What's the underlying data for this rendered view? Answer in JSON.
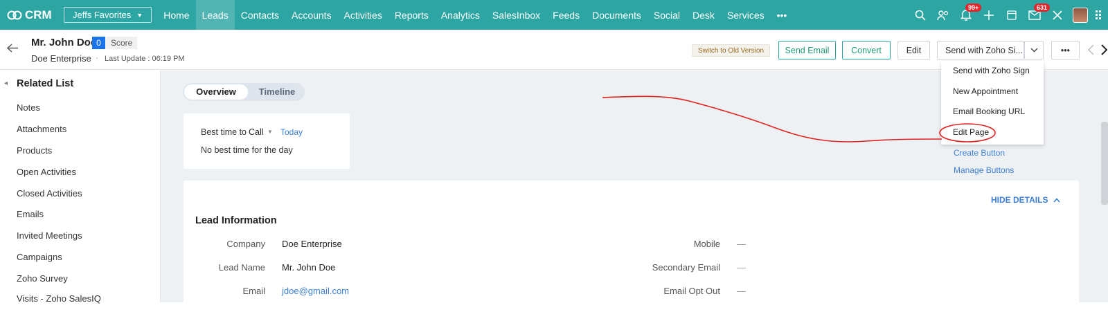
{
  "nav": {
    "app_name": "CRM",
    "favorites": "Jeffs Favorites",
    "tabs": [
      "Home",
      "Leads",
      "Contacts",
      "Accounts",
      "Activities",
      "Reports",
      "Analytics",
      "SalesInbox",
      "Feeds",
      "Documents",
      "Social",
      "Desk",
      "Services"
    ],
    "active_tab": "Leads",
    "more": "•••",
    "notification_badge": "99+",
    "mail_badge": "631",
    "icons": [
      "search-icon",
      "contacts-icon",
      "bell-icon",
      "plus-icon",
      "calendar-icon",
      "mail-icon",
      "tools-icon",
      "avatar",
      "apps-grid-icon"
    ],
    "accent_color": "#2ca5a3"
  },
  "record": {
    "name": "Mr. John Doe",
    "score_value": "0",
    "score_label": "Score",
    "company": "Doe Enterprise",
    "last_update": "Last Update : 06:19 PM"
  },
  "actions": {
    "switch_old": "Switch to Old Version",
    "send_email": "Send Email",
    "convert": "Convert",
    "edit": "Edit",
    "send_with_sign": "Send with Zoho Si...",
    "more": "•••"
  },
  "dropdown": {
    "items": [
      "Send with Zoho Sign",
      "New Appointment",
      "Email Booking URL",
      "Edit Page"
    ],
    "links": [
      "Create Button",
      "Manage Buttons"
    ]
  },
  "sidebar": {
    "title": "Related List",
    "items": [
      "Notes",
      "Attachments",
      "Products",
      "Open Activities",
      "Closed Activities",
      "Emails",
      "Invited Meetings",
      "Campaigns",
      "Zoho Survey",
      "Visits - Zoho SalesIQ"
    ]
  },
  "view_toggle": {
    "overview": "Overview",
    "timeline": "Timeline"
  },
  "best_time": {
    "label": "Best time to",
    "mode": "Call",
    "day": "Today",
    "empty": "No best time for the day"
  },
  "lead_info": {
    "hide_details": "HIDE DETAILS",
    "title": "Lead Information",
    "left_fields": [
      {
        "label": "Company",
        "value": "Doe Enterprise"
      },
      {
        "label": "Lead Name",
        "value": "Mr. John Doe"
      },
      {
        "label": "Email",
        "value": "jdoe@gmail.com"
      }
    ],
    "right_fields": [
      {
        "label": "Mobile",
        "value": "—"
      },
      {
        "label": "Secondary Email",
        "value": "—"
      },
      {
        "label": "Email Opt Out",
        "value": "—"
      }
    ]
  }
}
